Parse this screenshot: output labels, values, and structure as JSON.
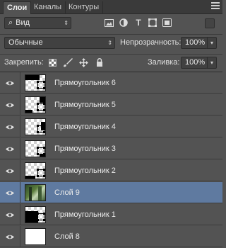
{
  "tabs": [
    {
      "label": "Слои",
      "active": true
    },
    {
      "label": "Каналы",
      "active": false
    },
    {
      "label": "Контуры",
      "active": false
    }
  ],
  "filter": {
    "value": "Вид"
  },
  "filter_icons": [
    "image-filter-icon",
    "adjustment-filter-icon",
    "type-filter-icon",
    "shape-filter-icon",
    "smart-object-filter-icon"
  ],
  "blend": {
    "mode": "Обычные",
    "opacity_label": "Непрозрачность:",
    "opacity": "100%"
  },
  "lock": {
    "label": "Закрепить:",
    "fill_label": "Заливка:",
    "fill": "100%"
  },
  "layers": [
    {
      "name": "Прямоугольник 6",
      "thumb": "rect6"
    },
    {
      "name": "Прямоугольник 5",
      "thumb": "rect5"
    },
    {
      "name": "Прямоугольник 4",
      "thumb": "rect4"
    },
    {
      "name": "Прямоугольник 3",
      "thumb": "rect3"
    },
    {
      "name": "Прямоугольник 2",
      "thumb": "rect2"
    },
    {
      "name": "Слой 9",
      "thumb": "photo",
      "selected": true
    },
    {
      "name": "Прямоугольник 1",
      "thumb": "rect1"
    },
    {
      "name": "Слой 8",
      "thumb": "white"
    }
  ],
  "colors": {
    "panel": "#535353",
    "tabbar": "#3a3a3a",
    "selected": "#5f7aa0"
  }
}
